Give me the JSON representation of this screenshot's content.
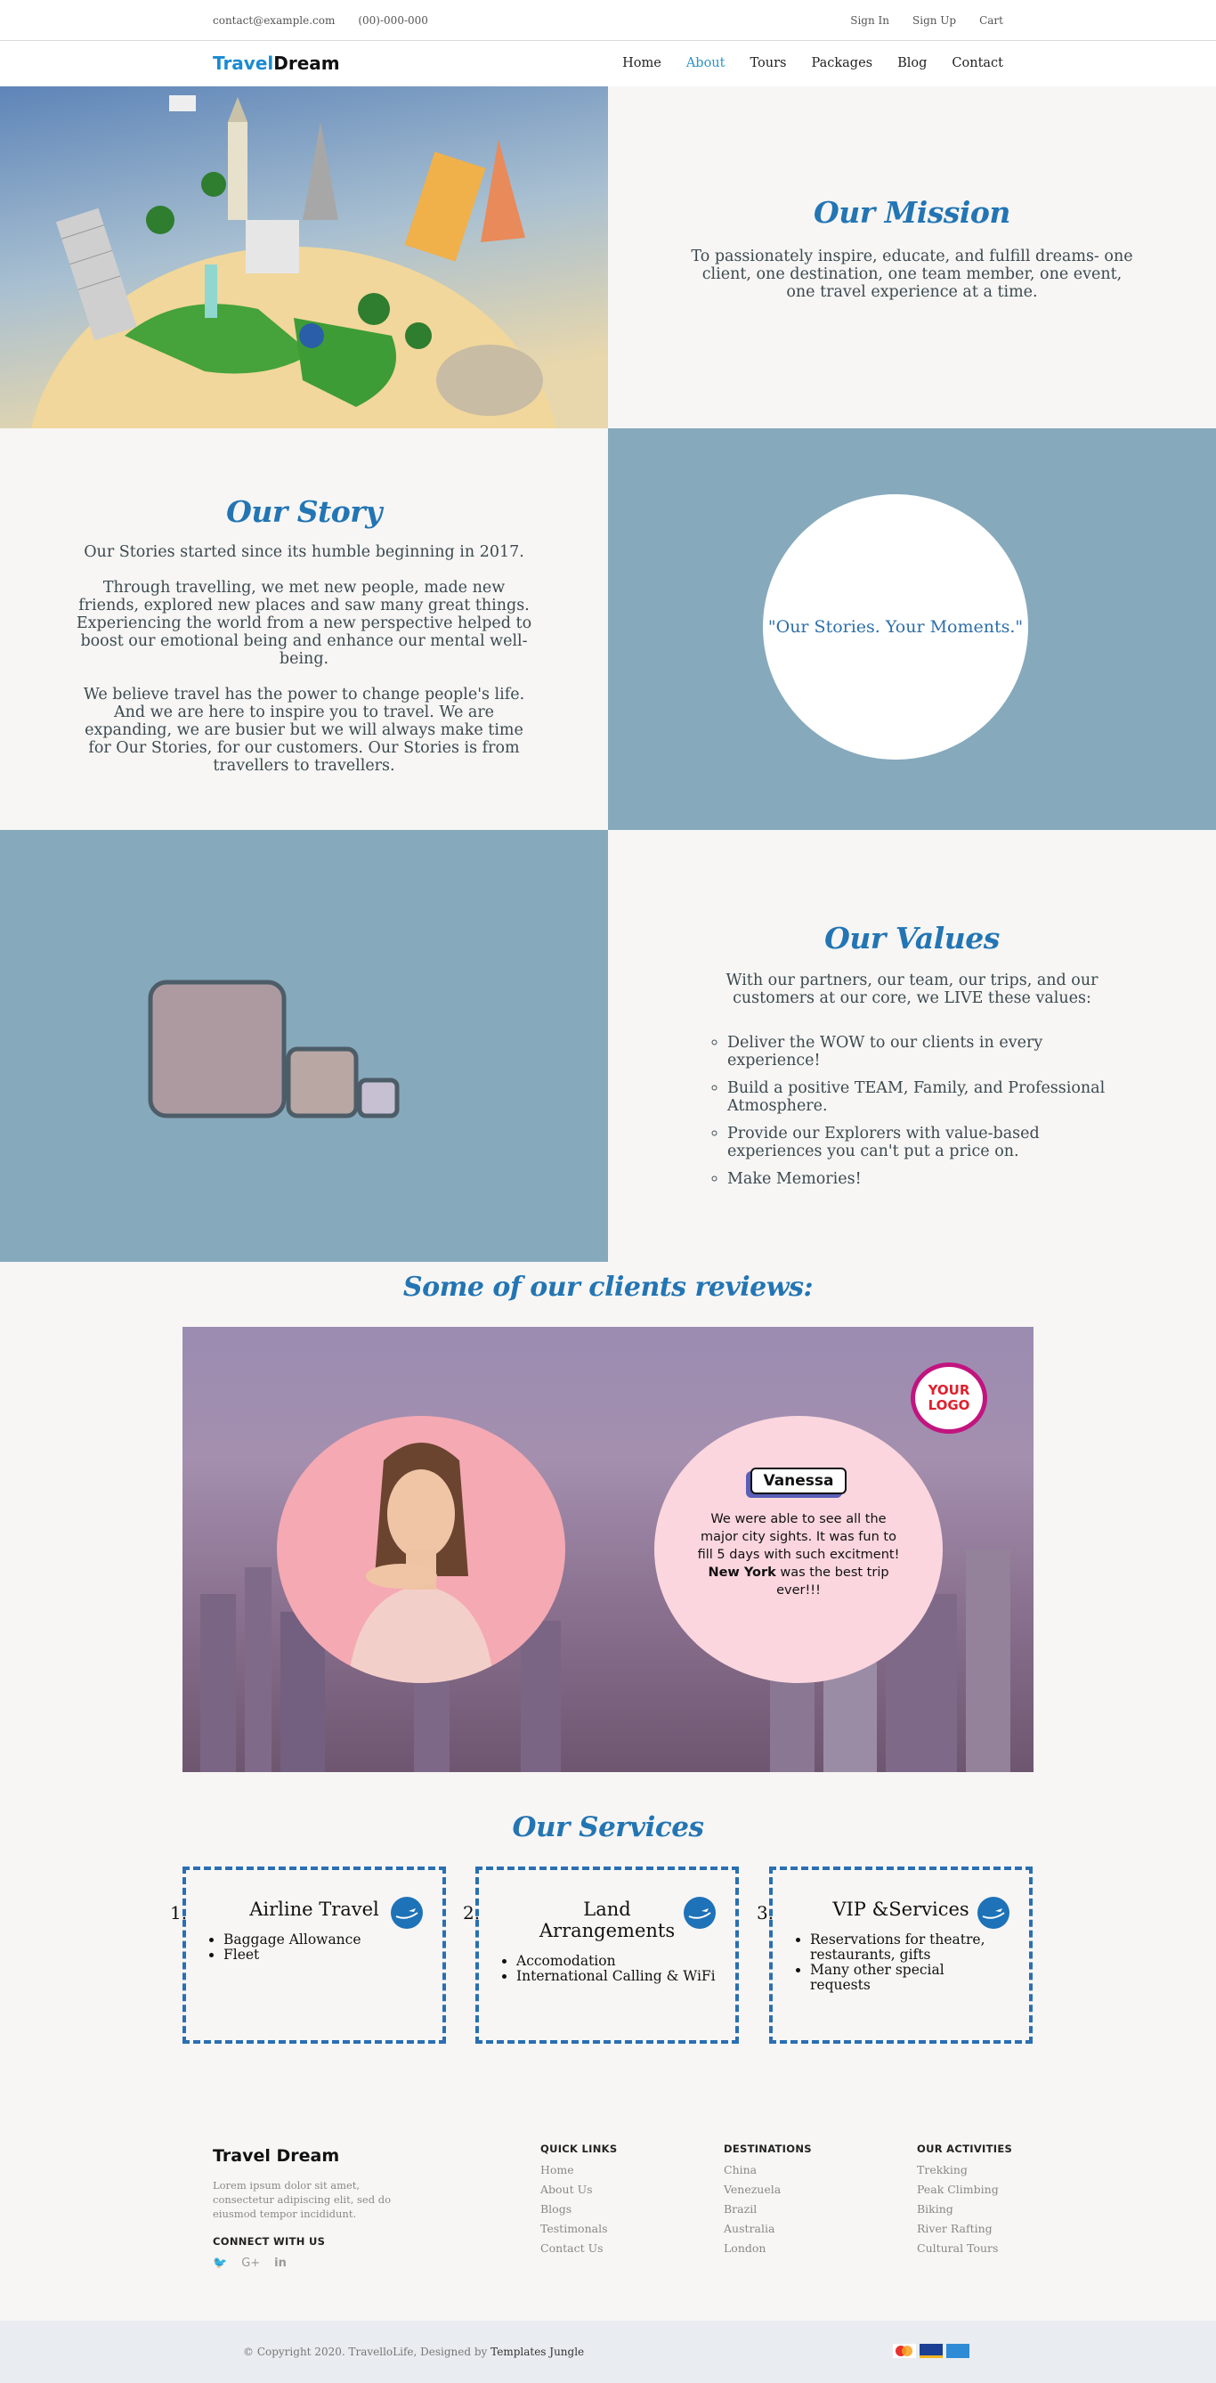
{
  "topbar": {
    "email": "contact@example.com",
    "phone": "(00)-000-000",
    "signin": "Sign In",
    "signup": "Sign Up",
    "cart": "Cart"
  },
  "brand": {
    "part1": "Travel",
    "part2": "Dream"
  },
  "nav": [
    {
      "label": "Home"
    },
    {
      "label": "About"
    },
    {
      "label": "Tours"
    },
    {
      "label": "Packages"
    },
    {
      "label": "Blog"
    },
    {
      "label": "Contact"
    }
  ],
  "mission": {
    "title": "Our Mission",
    "text": "To passionately inspire, educate, and fulfill dreams- one client, one destination, one team member, one event, one travel experience at a time."
  },
  "story": {
    "title": "Our Story",
    "p1": "Our Stories started since its humble beginning in 2017.",
    "p2": "Through travelling, we met new people, made new friends, explored new places and saw many great things. Experiencing the world from a new perspective helped to boost our emotional being and enhance our mental well-being.",
    "p3": "We believe travel has the power to change people's life. And we are here to inspire you to travel. We are expanding, we are busier but we will always make time for Our Stories, for our customers. Our Stories is from travellers to travellers.",
    "quote": "\"Our Stories. Your Moments.\""
  },
  "values": {
    "title": "Our Values",
    "intro": "With our partners, our team, our trips, and our customers at our core, we LIVE these values:",
    "items": [
      "Deliver the WOW to our clients in every experience!",
      "Build a positive TEAM, Family, and Professional Atmosphere.",
      "Provide our Explorers with value-based experiences you can't put a price on.",
      "Make Memories!"
    ]
  },
  "reviews": {
    "title": "Some of our clients reviews:",
    "logo_line1": "YOUR",
    "logo_line2": "LOGO",
    "name": "Vanessa",
    "text_before": "We were able to see all the major city sights. It was fun to fill 5 days with such excitment!",
    "highlight": "New York",
    "text_after": "was the best trip ever!!!"
  },
  "services": {
    "title": "Our Services",
    "items": [
      {
        "num": "1.",
        "title": "Airline Travel",
        "bullets": [
          "Baggage Allowance",
          "Fleet"
        ]
      },
      {
        "num": "2.",
        "title": "Land Arrangements",
        "bullets": [
          "Accomodation",
          "International Calling & WiFi"
        ]
      },
      {
        "num": "3.",
        "title": "VIP &Services",
        "bullets": [
          "Reservations for theatre, restaurants, gifts",
          "Many other special requests"
        ]
      }
    ]
  },
  "footer": {
    "brand": "Travel Dream",
    "about": "Lorem ipsum dolor sit amet, consectetur adipiscing elit, sed do eiusmod tempor incididunt.",
    "connect": "CONNECT WITH US",
    "quick_title": "QUICK LINKS",
    "quick": [
      "Home",
      "About Us",
      "Blogs",
      "Testimonals",
      "Contact Us"
    ],
    "dest_title": "DESTINATIONS",
    "dest": [
      "China",
      "Venezuela",
      "Brazil",
      "Australia",
      "London"
    ],
    "act_title": "OUR ACTIVITIES",
    "act": [
      "Trekking",
      "Peak Climbing",
      "Biking",
      "River Rafting",
      "Cultural Tours"
    ],
    "copyright": "© Copyright 2020. TravelloLife, Designed by",
    "designer": "Templates Jungle"
  },
  "colors": {
    "accent": "#2375b3",
    "panel_blue": "#86a9bc",
    "footer_bottom": "#e9ecf0"
  }
}
